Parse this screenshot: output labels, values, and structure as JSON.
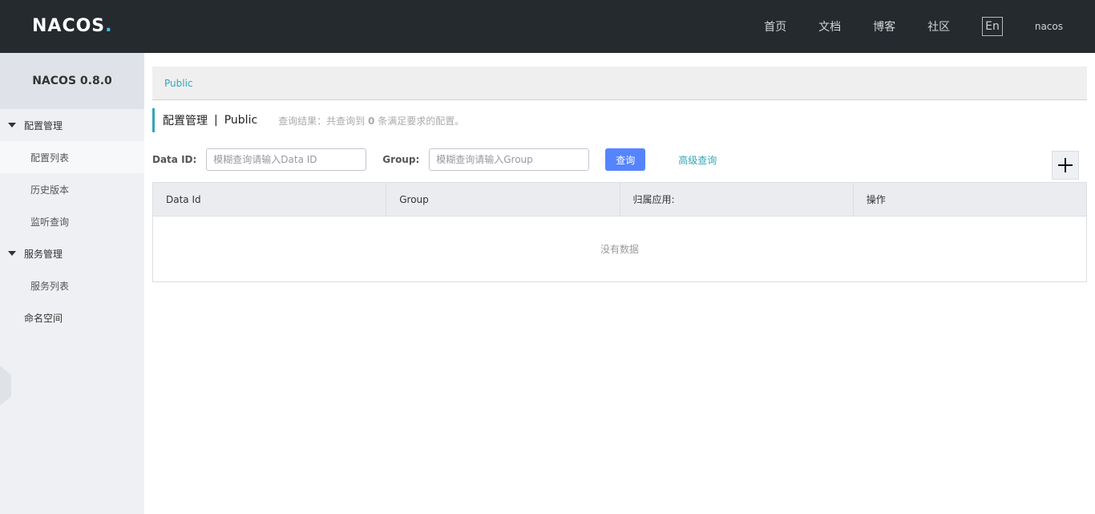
{
  "header": {
    "logo_text": "NACOS",
    "logo_dot": ".",
    "nav": [
      "首页",
      "文档",
      "博客",
      "社区"
    ],
    "lang": "En",
    "user": "nacos"
  },
  "sidebar": {
    "version": "NACOS 0.8.0",
    "groups": [
      {
        "label": "配置管理",
        "items": [
          "配置列表",
          "历史版本",
          "监听查询"
        ]
      },
      {
        "label": "服务管理",
        "items": [
          "服务列表"
        ]
      }
    ],
    "namespace": "命名空间"
  },
  "namespace_bar": {
    "current": "Public"
  },
  "page": {
    "title": "配置管理",
    "separator": "|",
    "namespace": "Public",
    "result_prefix": "查询结果：共查询到",
    "result_count": "0",
    "result_suffix": "条满足要求的配置。"
  },
  "filter": {
    "dataid_label": "Data ID:",
    "dataid_placeholder": "模糊查询请输入Data ID",
    "dataid_value": "",
    "group_label": "Group:",
    "group_placeholder": "模糊查询请输入Group",
    "group_value": "",
    "query_button": "查询",
    "advanced_link": "高级查询"
  },
  "table": {
    "columns": [
      "Data Id",
      "Group",
      "归属应用:",
      "操作"
    ],
    "empty_text": "没有数据"
  },
  "colors": {
    "header_bg": "#252a2f",
    "accent": "#33a6b8",
    "primary_button": "#5584ff",
    "sidebar_bg": "#eef0f4"
  }
}
